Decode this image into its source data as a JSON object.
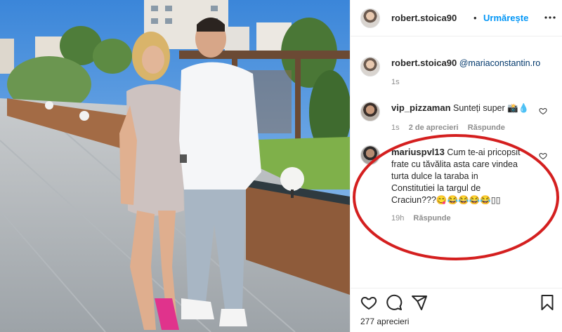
{
  "post": {
    "author": "robert.stoica90",
    "follow_label": "Urmărește",
    "separator": "•",
    "caption_mention": "@mariaconstantin.ro",
    "caption_time": "1s"
  },
  "comments": [
    {
      "username": "vip_pizzaman",
      "text": "Sunteți super 📸💧",
      "time": "1s",
      "likes": "2 de aprecieri",
      "reply": "Răspunde"
    },
    {
      "username": "mariuspvl13",
      "text_lines": [
        "Cum te-ai pricopsit",
        "frate cu tăvălita asta care vindea",
        "turta dulce la taraba in",
        "Constitutiei la targul de",
        "Craciun???😋😂😂😂😂▯▯"
      ],
      "time": "19h",
      "reply": "Răspunde"
    }
  ],
  "footer": {
    "likes_count": "277 aprecieri"
  },
  "colors": {
    "accent": "#0095f6",
    "highlight_ellipse": "#d41f1f"
  },
  "icons": [
    "heart-icon",
    "comment-icon",
    "share-icon",
    "bookmark-icon",
    "like-comment-icon"
  ]
}
